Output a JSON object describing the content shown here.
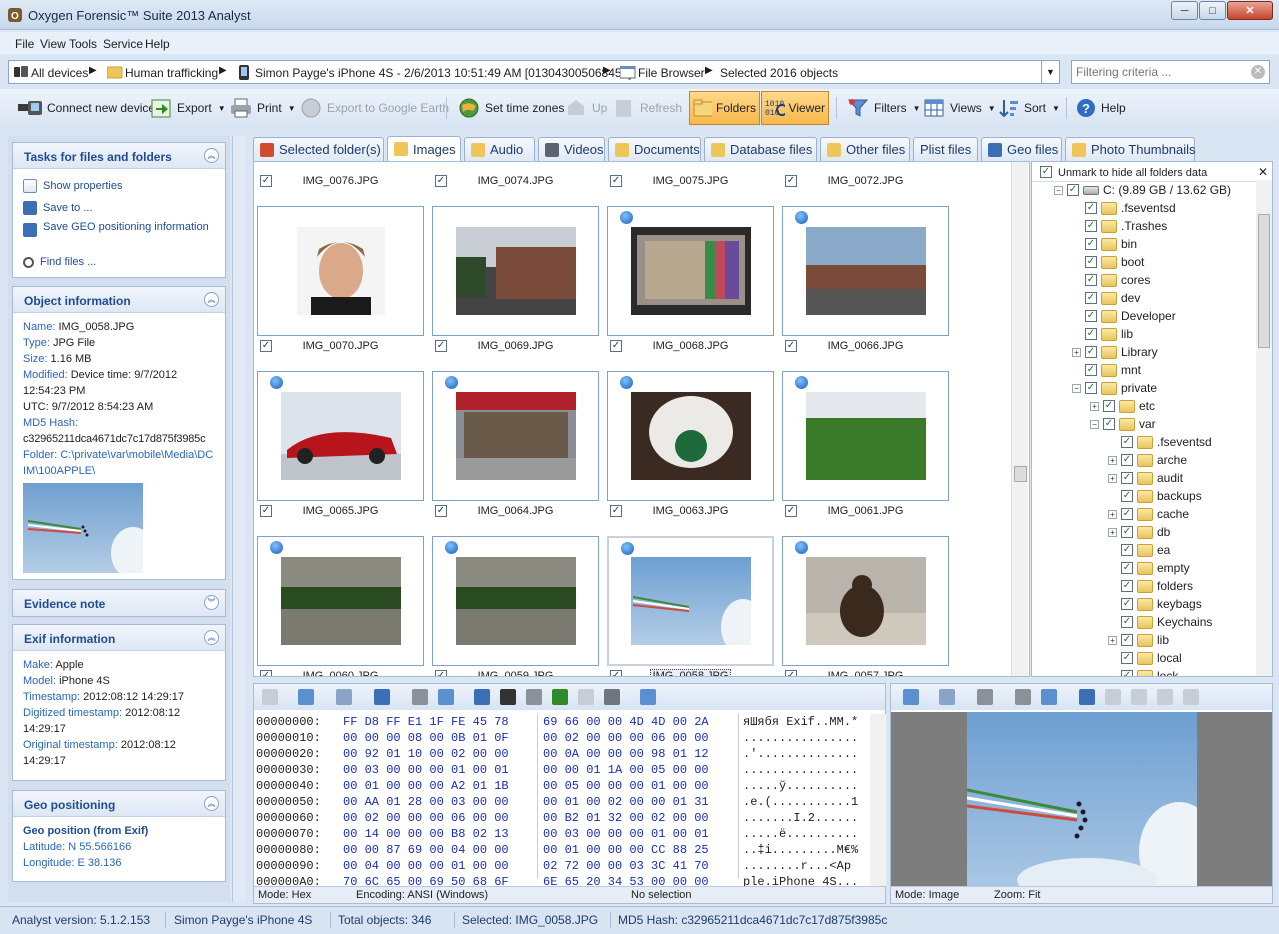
{
  "window": {
    "title": "Oxygen Forensic™ Suite 2013 Analyst",
    "min_glyph": "─",
    "max_glyph": "□",
    "close_glyph": "✕"
  },
  "menu": [
    "File",
    "View",
    "Tools",
    "Service",
    "Help"
  ],
  "breadcrumb": {
    "items": [
      {
        "label": "All devices",
        "icon": "devices-icon"
      },
      {
        "label": "Human trafficking",
        "icon": "folder-icon"
      },
      {
        "label": "Simon Payge's iPhone 4S - 2/6/2013 10:51:49 AM [013043005068452]",
        "icon": "phone-icon"
      },
      {
        "label": "File Browser",
        "icon": "file-browser-icon"
      },
      {
        "label": "Selected 2016 objects",
        "icon": ""
      }
    ],
    "separator": "▶",
    "dropdown_glyph": "▼"
  },
  "filter": {
    "placeholder": "Filtering criteria ...",
    "clear_glyph": "✕"
  },
  "toolbar": {
    "connect": "Connect new device",
    "export": "Export",
    "print": "Print",
    "google_earth": "Export to Google Earth",
    "time_zones": "Set time zones",
    "up": "Up",
    "refresh": "Refresh",
    "folders": "Folders",
    "viewer": "Viewer",
    "filters": "Filters",
    "views": "Views",
    "sort": "Sort",
    "help": "Help",
    "dropdown_glyph": "▼"
  },
  "left_panel": {
    "tasks": {
      "title": "Tasks for files and folders",
      "items": [
        "Show properties",
        "Save to ...",
        "Save GEO positioning information",
        "Find files ..."
      ]
    },
    "object_info": {
      "title": "Object information",
      "name_k": "Name:",
      "name_v": "IMG_0058.JPG",
      "type_k": "Type:",
      "type_v": "JPG File",
      "size_k": "Size:",
      "size_v": "1.16 MB",
      "modified_k": "Modified:",
      "modified_v": "Device time: 9/7/2012 12:54:23 PM",
      "utc_v": "UTC: 9/7/2012 8:54:23 AM",
      "md5_k": "MD5 Hash:",
      "md5_v": "c32965211dca4671dc7c17d875f3985c",
      "folder_k": "Folder:",
      "folder_v": "C:\\private\\var\\mobile\\Media\\DCIM\\100APPLE\\"
    },
    "evidence": {
      "title": "Evidence note"
    },
    "exif": {
      "title": "Exif information",
      "make_k": "Make:",
      "make_v": "Apple",
      "model_k": "Model:",
      "model_v": "iPhone 4S",
      "ts_k": "Timestamp:",
      "ts_v": "2012:08:12 14:29:17",
      "dts_k": "Digitized timestamp:",
      "dts_v": "2012:08:12 14:29:17",
      "ots_k": "Original timestamp:",
      "ots_v": "2012:08:12 14:29:17"
    },
    "geo": {
      "title": "Geo positioning",
      "subtitle": "Geo position (from Exif)",
      "lat_k": "Latitude:",
      "lat_v": "N 55.566166",
      "lon_k": "Longitude:",
      "lon_v": "E 38.136"
    },
    "collapse_glyph": "︽",
    "expand_glyph": "︾"
  },
  "tabs": [
    {
      "label": "Selected folder(s)",
      "selected": false
    },
    {
      "label": "Images",
      "selected": true
    },
    {
      "label": "Audio",
      "selected": false
    },
    {
      "label": "Videos",
      "selected": false
    },
    {
      "label": "Documents",
      "selected": false
    },
    {
      "label": "Database files",
      "selected": false
    },
    {
      "label": "Other files",
      "selected": false
    },
    {
      "label": "Plist files",
      "selected": false
    },
    {
      "label": "Geo files",
      "selected": false
    },
    {
      "label": "Photo Thumbnails",
      "selected": false
    }
  ],
  "gallery": {
    "check_glyph": "✓",
    "top_row": [
      "IMG_0076.JPG",
      "IMG_0074.JPG",
      "IMG_0075.JPG",
      "IMG_0072.JPG"
    ],
    "rows": [
      [
        {
          "name": "IMG_0070.JPG",
          "geo": false,
          "pic": "portrait"
        },
        {
          "name": "IMG_0069.JPG",
          "geo": false,
          "pic": "building"
        },
        {
          "name": "IMG_0068.JPG",
          "geo": true,
          "pic": "frame"
        },
        {
          "name": "IMG_0066.JPG",
          "geo": true,
          "pic": "street"
        }
      ],
      [
        {
          "name": "IMG_0065.JPG",
          "geo": true,
          "pic": "car"
        },
        {
          "name": "IMG_0064.JPG",
          "geo": true,
          "pic": "store"
        },
        {
          "name": "IMG_0063.JPG",
          "geo": true,
          "pic": "cup"
        },
        {
          "name": "IMG_0061.JPG",
          "geo": true,
          "pic": "field"
        }
      ],
      [
        {
          "name": "IMG_0060.JPG",
          "geo": true,
          "pic": "water"
        },
        {
          "name": "IMG_0059.JPG",
          "geo": true,
          "pic": "water"
        },
        {
          "name": "IMG_0058.JPG",
          "geo": true,
          "pic": "sky",
          "selected": true
        },
        {
          "name": "IMG_0057.JPG",
          "geo": true,
          "pic": "bear"
        }
      ]
    ]
  },
  "tree": {
    "header": "Unmark to hide all folders data",
    "close_glyph": "✕",
    "check_glyph": "✓",
    "nodes": [
      {
        "label": "C: (9.89 GB / 13.62 GB)",
        "level": 0,
        "exp": "−",
        "drive": true
      },
      {
        "label": ".fseventsd",
        "level": 1,
        "exp": ""
      },
      {
        "label": ".Trashes",
        "level": 1,
        "exp": ""
      },
      {
        "label": "bin",
        "level": 1,
        "exp": ""
      },
      {
        "label": "boot",
        "level": 1,
        "exp": ""
      },
      {
        "label": "cores",
        "level": 1,
        "exp": ""
      },
      {
        "label": "dev",
        "level": 1,
        "exp": ""
      },
      {
        "label": "Developer",
        "level": 1,
        "exp": ""
      },
      {
        "label": "lib",
        "level": 1,
        "exp": ""
      },
      {
        "label": "Library",
        "level": 1,
        "exp": "+"
      },
      {
        "label": "mnt",
        "level": 1,
        "exp": ""
      },
      {
        "label": "private",
        "level": 1,
        "exp": "−"
      },
      {
        "label": "etc",
        "level": 2,
        "exp": "+"
      },
      {
        "label": "var",
        "level": 2,
        "exp": "−"
      },
      {
        "label": ".fseventsd",
        "level": 3,
        "exp": ""
      },
      {
        "label": "arche",
        "level": 3,
        "exp": "+"
      },
      {
        "label": "audit",
        "level": 3,
        "exp": "+"
      },
      {
        "label": "backups",
        "level": 3,
        "exp": ""
      },
      {
        "label": "cache",
        "level": 3,
        "exp": "+"
      },
      {
        "label": "db",
        "level": 3,
        "exp": "+"
      },
      {
        "label": "ea",
        "level": 3,
        "exp": ""
      },
      {
        "label": "empty",
        "level": 3,
        "exp": ""
      },
      {
        "label": "folders",
        "level": 3,
        "exp": ""
      },
      {
        "label": "keybags",
        "level": 3,
        "exp": ""
      },
      {
        "label": "Keychains",
        "level": 3,
        "exp": ""
      },
      {
        "label": "lib",
        "level": 3,
        "exp": "+"
      },
      {
        "label": "local",
        "level": 3,
        "exp": ""
      },
      {
        "label": "lock",
        "level": 3,
        "exp": ""
      }
    ]
  },
  "hex": {
    "rows": [
      {
        "off": "00000000:",
        "h1": "FF D8 FF E1 1F FE 45 78",
        "h2": "69 66 00 00 4D 4D 00 2A",
        "asc": "яШябя Exif..MM.*"
      },
      {
        "off": "00000010:",
        "h1": "00 00 00 08 00 0B 01 0F",
        "h2": "00 02 00 00 00 06 00 00",
        "asc": "................"
      },
      {
        "off": "00000020:",
        "h1": "00 92 01 10 00 02 00 00",
        "h2": "00 0A 00 00 00 98 01 12",
        "asc": ".'.............."
      },
      {
        "off": "00000030:",
        "h1": "00 03 00 00 00 01 00 01",
        "h2": "00 00 01 1A 00 05 00 00",
        "asc": "................"
      },
      {
        "off": "00000040:",
        "h1": "00 01 00 00 00 A2 01 1B",
        "h2": "00 05 00 00 00 01 00 00",
        "asc": ".....ў.........."
      },
      {
        "off": "00000050:",
        "h1": "00 AA 01 28 00 03 00 00",
        "h2": "00 01 00 02 00 00 01 31",
        "asc": ".е.(...........1"
      },
      {
        "off": "00000060:",
        "h1": "00 02 00 00 00 06 00 00",
        "h2": "00 B2 01 32 00 02 00 00",
        "asc": ".......I.2......"
      },
      {
        "off": "00000070:",
        "h1": "00 14 00 00 00 B8 02 13",
        "h2": "00 03 00 00 00 01 00 01",
        "asc": ".....ё.........."
      },
      {
        "off": "00000080:",
        "h1": "00 00 87 69 00 04 00 00",
        "h2": "00 01 00 00 00 CC 88 25",
        "asc": "..‡i.........М€%"
      },
      {
        "off": "00000090:",
        "h1": "00 04 00 00 00 01 00 00",
        "h2": "02 72 00 00 03 3C 41 70",
        "asc": "........r...<Ap"
      },
      {
        "off": "000000A0:",
        "h1": "70 6C 65 00 69 50 68 6F",
        "h2": "6E 65 20 34 53 00 00 00",
        "asc": "ple.iPhone 4S..."
      }
    ],
    "mode": "Mode: Hex",
    "encoding": "Encoding: ANSI (Windows)",
    "selection": "No selection"
  },
  "viewer": {
    "mode": "Mode: Image",
    "zoom": "Zoom: Fit"
  },
  "status": {
    "version": "Analyst version: 5.1.2.153",
    "device": "Simon Payge's iPhone 4S",
    "total": "Total objects: 346",
    "selected": "Selected: IMG_0058.JPG",
    "md5": "MD5 Hash: c32965211dca4671dc7c17d875f3985c"
  }
}
